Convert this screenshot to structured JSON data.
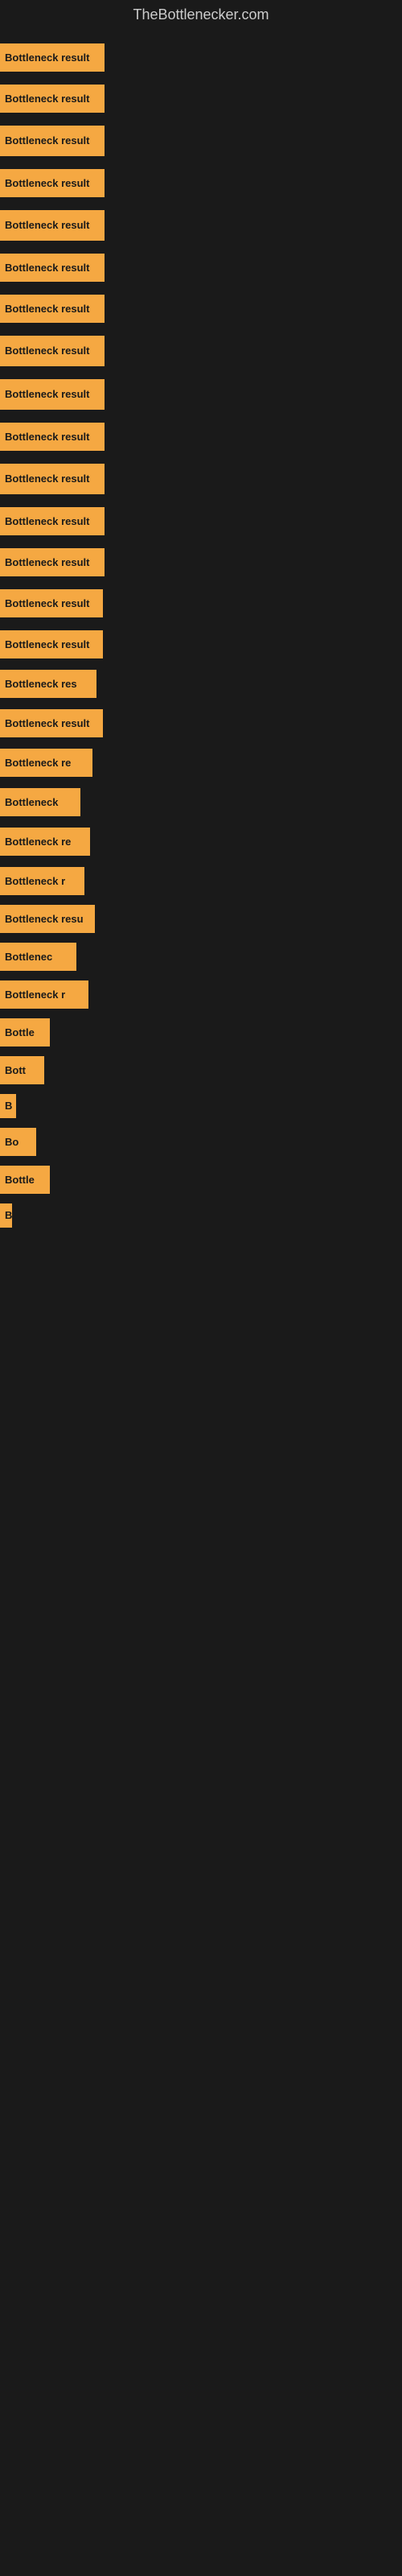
{
  "site": {
    "title": "TheBottlenecker.com"
  },
  "items": [
    {
      "id": 1,
      "label": "Bottleneck result"
    },
    {
      "id": 2,
      "label": "Bottleneck result"
    },
    {
      "id": 3,
      "label": "Bottleneck result"
    },
    {
      "id": 4,
      "label": "Bottleneck result"
    },
    {
      "id": 5,
      "label": "Bottleneck result"
    },
    {
      "id": 6,
      "label": "Bottleneck result"
    },
    {
      "id": 7,
      "label": "Bottleneck result"
    },
    {
      "id": 8,
      "label": "Bottleneck result"
    },
    {
      "id": 9,
      "label": "Bottleneck result"
    },
    {
      "id": 10,
      "label": "Bottleneck result"
    },
    {
      "id": 11,
      "label": "Bottleneck result"
    },
    {
      "id": 12,
      "label": "Bottleneck result"
    },
    {
      "id": 13,
      "label": "Bottleneck result"
    },
    {
      "id": 14,
      "label": "Bottleneck result"
    },
    {
      "id": 15,
      "label": "Bottleneck result"
    },
    {
      "id": 16,
      "label": "Bottleneck res"
    },
    {
      "id": 17,
      "label": "Bottleneck result"
    },
    {
      "id": 18,
      "label": "Bottleneck re"
    },
    {
      "id": 19,
      "label": "Bottleneck"
    },
    {
      "id": 20,
      "label": "Bottleneck re"
    },
    {
      "id": 21,
      "label": "Bottleneck r"
    },
    {
      "id": 22,
      "label": "Bottleneck resu"
    },
    {
      "id": 23,
      "label": "Bottlenec"
    },
    {
      "id": 24,
      "label": "Bottleneck r"
    },
    {
      "id": 25,
      "label": "Bottle"
    },
    {
      "id": 26,
      "label": "Bott"
    },
    {
      "id": 27,
      "label": "B"
    },
    {
      "id": 28,
      "label": "Bo"
    },
    {
      "id": 29,
      "label": "Bottle"
    },
    {
      "id": 30,
      "label": "B"
    }
  ]
}
